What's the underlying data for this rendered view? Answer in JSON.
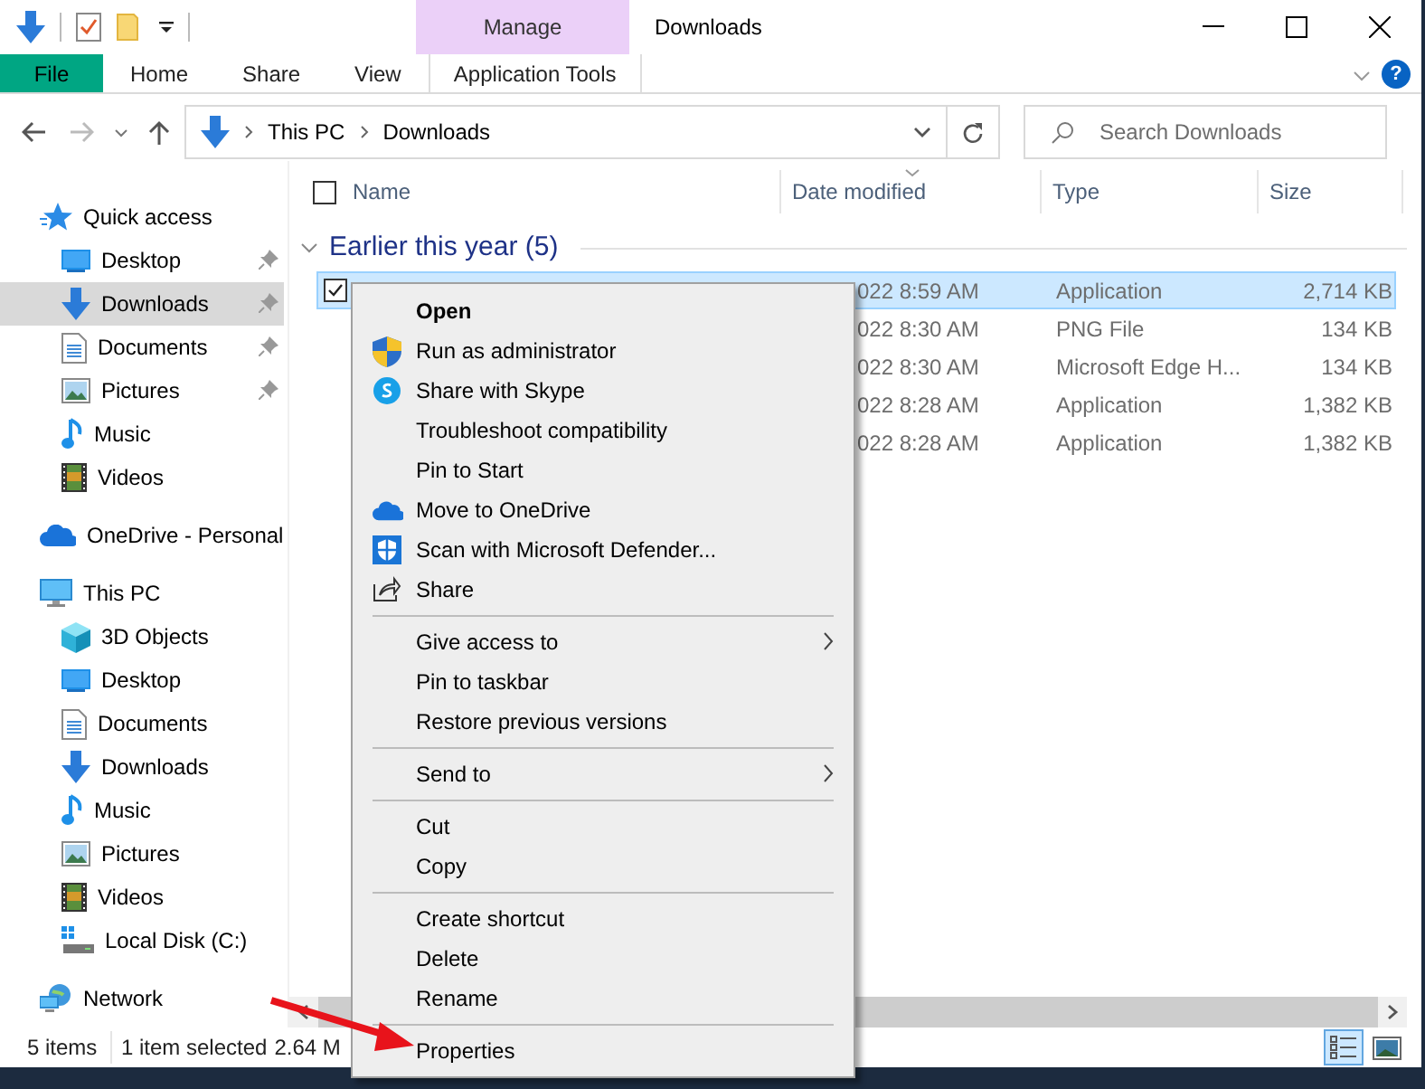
{
  "window": {
    "title": "Downloads"
  },
  "ribbon": {
    "context_group": "Manage",
    "help": "?",
    "tabs": [
      {
        "label": "File",
        "kind": "file"
      },
      {
        "label": "Home",
        "kind": "plain"
      },
      {
        "label": "Share",
        "kind": "plain"
      },
      {
        "label": "View",
        "kind": "plain"
      },
      {
        "label": "Application Tools",
        "kind": "context"
      }
    ]
  },
  "address": {
    "path": [
      "This PC",
      "Downloads"
    ]
  },
  "search": {
    "placeholder": "Search Downloads"
  },
  "sidebar": {
    "items": [
      {
        "label": "Quick access",
        "kind": "star",
        "selected": false,
        "children": [
          {
            "label": "Desktop",
            "kind": "desktop",
            "selected": false,
            "pinned": true
          },
          {
            "label": "Downloads",
            "kind": "download",
            "selected": true,
            "pinned": true
          },
          {
            "label": "Documents",
            "kind": "documents",
            "selected": false,
            "pinned": true
          },
          {
            "label": "Pictures",
            "kind": "pictures",
            "selected": false,
            "pinned": true
          },
          {
            "label": "Music",
            "kind": "music",
            "selected": false,
            "pinned": false
          },
          {
            "label": "Videos",
            "kind": "videos",
            "selected": false,
            "pinned": false
          }
        ]
      },
      {
        "label": "OneDrive - Personal",
        "kind": "cloud",
        "selected": false
      },
      {
        "label": "This PC",
        "kind": "pc",
        "selected": false,
        "children": [
          {
            "label": "3D Objects",
            "kind": "cube",
            "selected": false,
            "pinned": false
          },
          {
            "label": "Desktop",
            "kind": "desktop",
            "selected": false,
            "pinned": false
          },
          {
            "label": "Documents",
            "kind": "documents",
            "selected": false,
            "pinned": false
          },
          {
            "label": "Downloads",
            "kind": "download",
            "selected": false,
            "pinned": false
          },
          {
            "label": "Music",
            "kind": "music",
            "selected": false,
            "pinned": false
          },
          {
            "label": "Pictures",
            "kind": "pictures",
            "selected": false,
            "pinned": false
          },
          {
            "label": "Videos",
            "kind": "videos",
            "selected": false,
            "pinned": false
          },
          {
            "label": "Local Disk (C:)",
            "kind": "drive",
            "selected": false,
            "pinned": false
          }
        ]
      },
      {
        "label": "Network",
        "kind": "network",
        "selected": false
      }
    ]
  },
  "file_list": {
    "select_all": {
      "checked": false
    },
    "columns": [
      "Name",
      "Date modified",
      "Type",
      "Size"
    ],
    "group": "Earlier this year (5)",
    "rows": [
      {
        "selected": true,
        "date": "022 8:59 AM",
        "type": "Application",
        "size": "2,714 KB"
      },
      {
        "selected": false,
        "date": "022 8:30 AM",
        "type": "PNG File",
        "size": "134 KB"
      },
      {
        "selected": false,
        "date": "022 8:30 AM",
        "type": "Microsoft Edge H...",
        "size": "134 KB"
      },
      {
        "selected": false,
        "date": "022 8:28 AM",
        "type": "Application",
        "size": "1,382 KB"
      },
      {
        "selected": false,
        "date": "022 8:28 AM",
        "type": "Application",
        "size": "1,382 KB"
      }
    ]
  },
  "context_menu": {
    "items": [
      {
        "kind": "item",
        "label": "Open",
        "bold": true
      },
      {
        "kind": "shield",
        "label": "Run as administrator"
      },
      {
        "kind": "chat",
        "label": "Share with Skype"
      },
      {
        "kind": "item",
        "label": "Troubleshoot compatibility"
      },
      {
        "kind": "item",
        "label": "Pin to Start"
      },
      {
        "kind": "cloud",
        "label": "Move to OneDrive"
      },
      {
        "kind": "defender",
        "label": "Scan with Microsoft Defender..."
      },
      {
        "kind": "share",
        "label": "Share"
      },
      {
        "kind": "separator"
      },
      {
        "kind": "item",
        "label": "Give access to",
        "submenu": true
      },
      {
        "kind": "item",
        "label": "Pin to taskbar"
      },
      {
        "kind": "item",
        "label": "Restore previous versions"
      },
      {
        "kind": "separator"
      },
      {
        "kind": "item",
        "label": "Send to",
        "submenu": true
      },
      {
        "kind": "separator"
      },
      {
        "kind": "item",
        "label": "Cut"
      },
      {
        "kind": "item",
        "label": "Copy"
      },
      {
        "kind": "separator"
      },
      {
        "kind": "item",
        "label": "Create shortcut"
      },
      {
        "kind": "item",
        "label": "Delete"
      },
      {
        "kind": "item",
        "label": "Rename"
      },
      {
        "kind": "separator"
      },
      {
        "kind": "item",
        "label": "Properties"
      }
    ]
  },
  "status_bar": {
    "item_count": "5 items",
    "selection": "1 item selected",
    "size": "2.64 M"
  }
}
